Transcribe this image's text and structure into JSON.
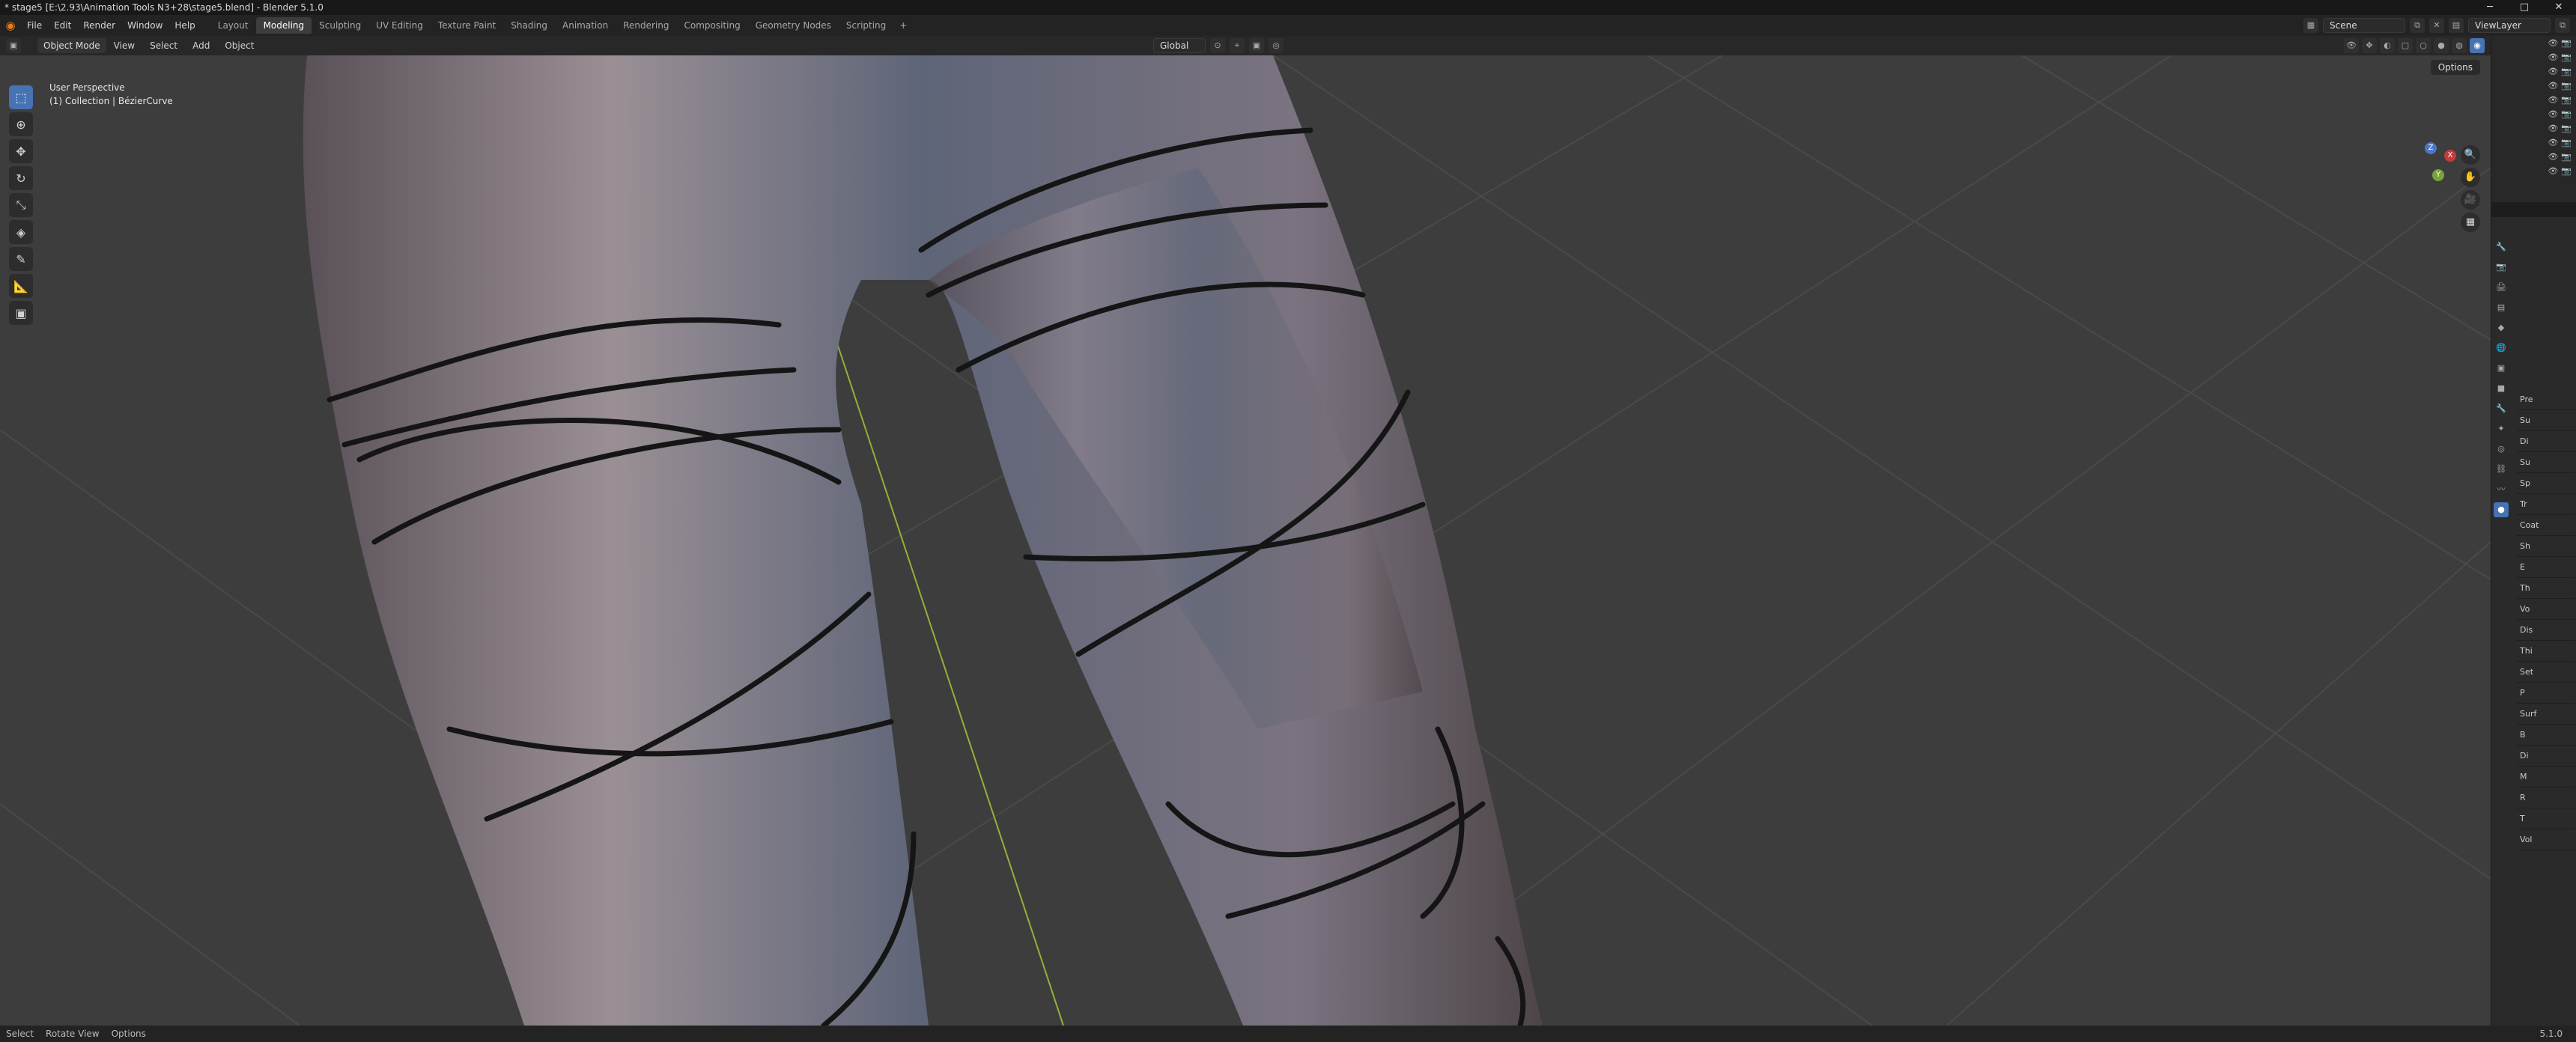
{
  "window": {
    "title": "* stage5 [E:\\2.93\\Animation Tools N3+28\\stage5.blend] - Blender 5.1.0",
    "buttons": [
      "─",
      "□",
      "✕"
    ]
  },
  "menu": {
    "items": [
      "File",
      "Edit",
      "Render",
      "Window",
      "Help"
    ]
  },
  "workspaces": [
    "Layout",
    "Modeling",
    "Sculpting",
    "UV Editing",
    "Texture Paint",
    "Shading",
    "Animation",
    "Rendering",
    "Compositing",
    "Geometry Nodes",
    "Scripting"
  ],
  "workspace_active": "Modeling",
  "scene": {
    "label": "Scene",
    "view_layer": "ViewLayer"
  },
  "viewport_header": {
    "mode": "Object Mode",
    "menus": [
      "View",
      "Select",
      "Add",
      "Object"
    ],
    "transform": "Global",
    "options": "Options"
  },
  "viewport_overlay": {
    "line1": "User Perspective",
    "line2": "(1) Collection | BézierCurve"
  },
  "gizmo": {
    "x": "X",
    "y": "Y",
    "z": "Z"
  },
  "properties": {
    "sections": [
      "Pre",
      "Su",
      "Di",
      "Su",
      "Sp",
      "Tr",
      "Coat",
      "Sh",
      "E",
      "Th",
      "Vo",
      "Dis",
      "Thi",
      "Set",
      "P",
      "Surf",
      "B",
      "Di",
      "M",
      "R",
      "T",
      "Vol"
    ]
  },
  "statusbar": {
    "select": "Select",
    "rotate": "Rotate View",
    "options": "Options",
    "version": "5.1.0"
  },
  "colors": {
    "accent": "#4772b3",
    "viewport_bg": "#3d3d3d",
    "grid": "#4a4a4a",
    "y_axis": "#8fb33a",
    "leg": "#6a6570",
    "wire": "#151515"
  }
}
